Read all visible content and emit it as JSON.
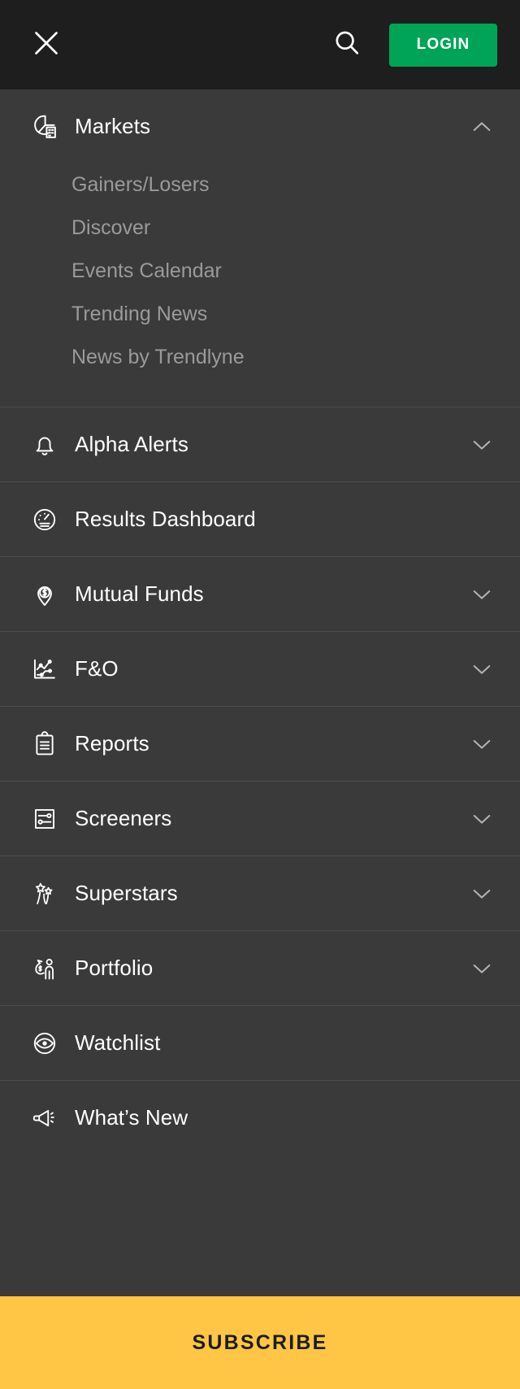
{
  "theme": {
    "header_bg": "#1e1e1e",
    "menu_bg": "#3a3a3a",
    "divider": "#4d4d4d",
    "text_primary": "#ffffff",
    "text_secondary": "#9a9a9a",
    "login_green": "#00a457",
    "subscribe_yellow": "#ffc645",
    "subscribe_text": "#1d1d1d"
  },
  "header": {
    "close_icon": "close-icon",
    "search_icon": "search-icon",
    "login_label": "LOGIN"
  },
  "menu": {
    "items": [
      {
        "label": "Markets",
        "icon": "markets-icon",
        "expandable": true,
        "expanded": true,
        "chevron": "chevron-up-icon",
        "submenu": [
          {
            "label": "Gainers/Losers"
          },
          {
            "label": "Discover"
          },
          {
            "label": "Events Calendar"
          },
          {
            "label": "Trending News"
          },
          {
            "label": "News by Trendlyne"
          }
        ]
      },
      {
        "label": "Alpha Alerts",
        "icon": "bell-icon",
        "expandable": true,
        "expanded": false,
        "chevron": "chevron-down-icon",
        "submenu": []
      },
      {
        "label": "Results Dashboard",
        "icon": "gauge-icon",
        "expandable": false,
        "expanded": false,
        "chevron": "",
        "submenu": []
      },
      {
        "label": "Mutual Funds",
        "icon": "dollar-pin-icon",
        "expandable": true,
        "expanded": false,
        "chevron": "chevron-down-icon",
        "submenu": []
      },
      {
        "label": "F&O",
        "icon": "line-chart-icon",
        "expandable": true,
        "expanded": false,
        "chevron": "chevron-down-icon",
        "submenu": []
      },
      {
        "label": "Reports",
        "icon": "clipboard-icon",
        "expandable": true,
        "expanded": false,
        "chevron": "chevron-down-icon",
        "submenu": []
      },
      {
        "label": "Screeners",
        "icon": "filter-sliders-icon",
        "expandable": true,
        "expanded": false,
        "chevron": "chevron-down-icon",
        "submenu": []
      },
      {
        "label": "Superstars",
        "icon": "sparkler-stars-icon",
        "expandable": true,
        "expanded": false,
        "chevron": "chevron-down-icon",
        "submenu": []
      },
      {
        "label": "Portfolio",
        "icon": "money-bag-person-icon",
        "expandable": true,
        "expanded": false,
        "chevron": "chevron-down-icon",
        "submenu": []
      },
      {
        "label": "Watchlist",
        "icon": "eye-icon",
        "expandable": false,
        "expanded": false,
        "chevron": "",
        "submenu": []
      },
      {
        "label": "What’s New",
        "icon": "megaphone-icon",
        "expandable": false,
        "expanded": false,
        "chevron": "",
        "submenu": []
      }
    ]
  },
  "footer": {
    "subscribe_label": "SUBSCRIBE"
  }
}
